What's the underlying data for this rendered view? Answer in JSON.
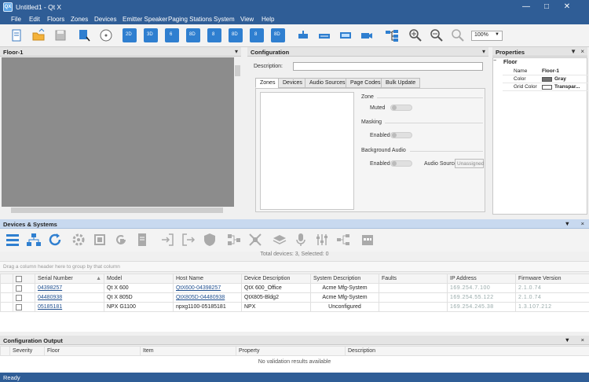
{
  "window": {
    "title": "Untitled1 - Qt X",
    "app_icon": "QX"
  },
  "menu": [
    "File",
    "Edit",
    "Floors",
    "Zones",
    "Devices",
    "Emitter Speaker",
    "Paging Stations",
    "System",
    "View",
    "Help"
  ],
  "toolbar": {
    "zoom": "100%",
    "icon_labels": [
      "2D",
      "3D",
      "6",
      "8D",
      "8",
      "8D",
      "8",
      "8D"
    ]
  },
  "floor_panel": {
    "title": "Floor-1"
  },
  "configuration": {
    "title": "Configuration",
    "description_label": "Description:",
    "tabs": [
      "Zones",
      "Devices",
      "Audio Sources",
      "Page Codes",
      "Bulk Update"
    ],
    "zone_section": "Zone",
    "muted_label": "Muted",
    "masking_section": "Masking",
    "masking_enabled_label": "Enabled",
    "bg_section": "Background Audio",
    "bg_enabled_label": "Enabled",
    "audio_source_label": "Audio Source",
    "audio_source_value": "Unassigned"
  },
  "properties": {
    "title": "Properties",
    "group": "Floor",
    "rows": [
      {
        "name": "Name",
        "value": "Floor-1"
      },
      {
        "name": "Color",
        "value": "Gray",
        "swatch": "#707070"
      },
      {
        "name": "Grid Color",
        "value": "Transpar...",
        "swatch": "#ffffff"
      }
    ]
  },
  "devices": {
    "title": "Devices & Systems",
    "total_label": "Total devices: 3, Selected: 0",
    "group_hint": "Drag a column header here to group by that column",
    "columns": [
      "Serial Number",
      "Model",
      "Host Name",
      "Device Description",
      "System Description",
      "Faults",
      "IP Address",
      "Firmware Version"
    ],
    "rows": [
      {
        "serial": "04398257",
        "model": "Qt X 600",
        "host": "QtX600-04398257",
        "desc": "QtX 600_Office",
        "system": "Acme Mfg-System",
        "faults": "",
        "ip": "169.254.7.100",
        "fw": "2.1.0.74"
      },
      {
        "serial": "04480938",
        "model": "Qt X 805D",
        "host": "QtX805D-04480938",
        "desc": "QtX805-Bldg2",
        "system": "Acme Mfg-System",
        "faults": "",
        "ip": "169.254.55.122",
        "fw": "2.1.0.74"
      },
      {
        "serial": "05185181",
        "model": "NPX G1100",
        "host": "npxg1100-05185181",
        "desc": "NPX",
        "system": "Unconfigured",
        "faults": "",
        "ip": "169.254.245.38",
        "fw": "1.3.107.212"
      }
    ]
  },
  "output": {
    "title": "Configuration Output",
    "columns": [
      "Severity",
      "Floor",
      "Item",
      "Property",
      "Description"
    ],
    "empty_text": "No validation results available"
  },
  "status": {
    "text": "Ready"
  },
  "colors": {
    "titlebar": "#2f5d96",
    "accent": "#2f7fd0",
    "devices_header": "#c8d9ef"
  }
}
